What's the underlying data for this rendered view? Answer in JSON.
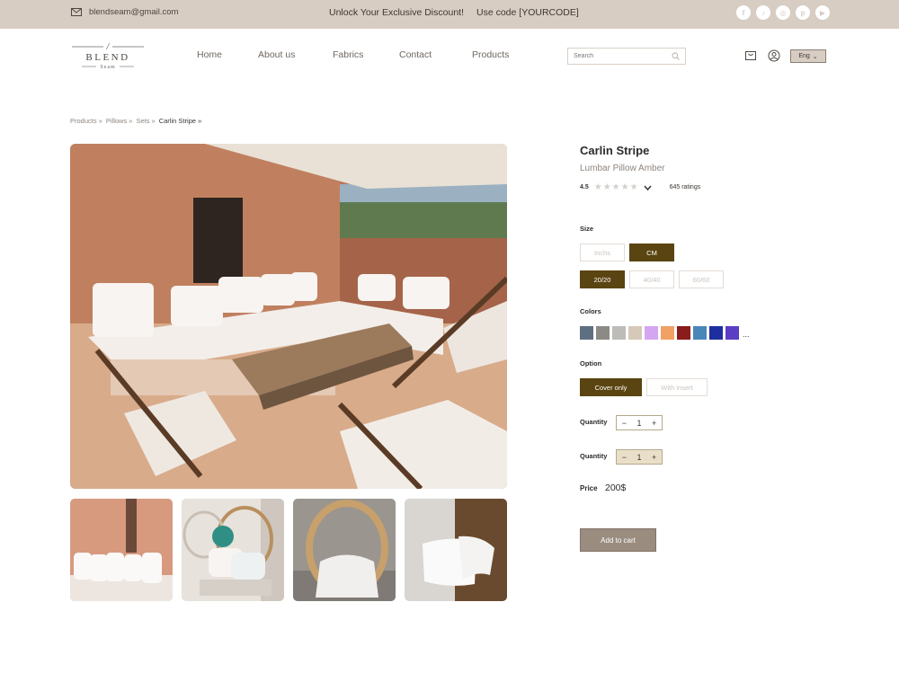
{
  "topbar": {
    "email": "blendseam@gmail.com",
    "promo_text": "Unlock Your Exclusive Discount!",
    "promo_code": "Use code [YOURCODE]",
    "socials": [
      "facebook-icon",
      "tiktok-icon",
      "instagram-icon",
      "pinterest-icon",
      "youtube-icon"
    ]
  },
  "header": {
    "logo_line1": "BLEND",
    "logo_line2": "Seam",
    "nav": [
      "Home",
      "About us",
      "Fabrics",
      "Contact",
      "Products"
    ],
    "search_placeholder": "Search",
    "lang": "Eng"
  },
  "breadcrumb": [
    "Products »",
    "Pillows »",
    "Sets »",
    "Carlin Stripe »"
  ],
  "product": {
    "title": "Carlin Stripe",
    "subtitle": "Lumbar Pillow Amber",
    "rating": "4.5",
    "ratings_count": "645 ratings",
    "size_label": "Size",
    "units": [
      "Inchs",
      "CM"
    ],
    "sizes": [
      "20/20",
      "40/40",
      "60/60"
    ],
    "colors_label": "Colors",
    "colors": [
      "#5f6f82",
      "#8c8a85",
      "#bdbcb9",
      "#d6c9b8",
      "#d4a6f2",
      "#f2a165",
      "#8a1c1c",
      "#4b86b8",
      "#1f2e9e",
      "#5a3ec4"
    ],
    "more": "...",
    "option_label": "Option",
    "options": [
      "Cover only",
      "With insert"
    ],
    "quantity_label": "Quantity",
    "quantity_1": "1",
    "quantity_2": "1",
    "price_label": "Price",
    "price": "200$",
    "cart_button": "Add to cart"
  },
  "accent": "#5a4411",
  "topbar_color": "#d8cdc3"
}
